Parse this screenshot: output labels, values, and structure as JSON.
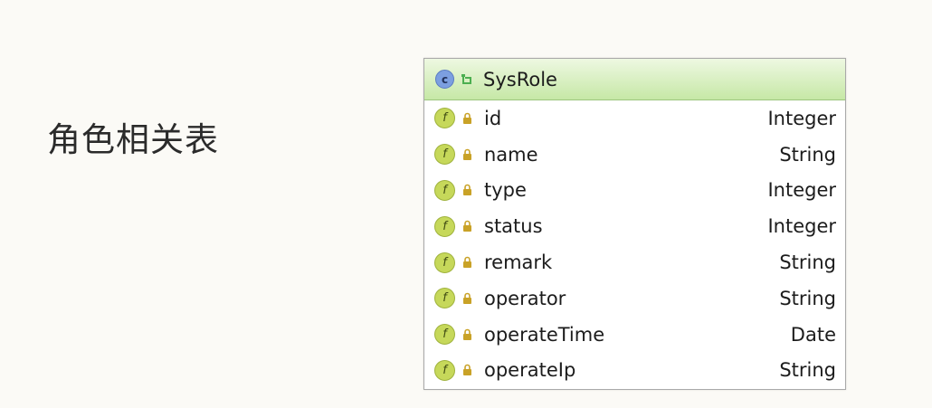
{
  "page_title": "角色相关表",
  "class_panel": {
    "class_icon_letter": "c",
    "class_name": "SysRole",
    "field_icon_letter": "f",
    "fields": [
      {
        "name": "id",
        "type": "Integer"
      },
      {
        "name": "name",
        "type": "String"
      },
      {
        "name": "type",
        "type": "Integer"
      },
      {
        "name": "status",
        "type": "Integer"
      },
      {
        "name": "remark",
        "type": "String"
      },
      {
        "name": "operator",
        "type": "String"
      },
      {
        "name": "operateTime",
        "type": "Date"
      },
      {
        "name": "operateIp",
        "type": "String"
      }
    ]
  },
  "icons": {
    "class": "class-icon",
    "visibility": "public-icon",
    "field": "field-icon",
    "lock": "lock-icon"
  },
  "colors": {
    "header_gradient_top": "#eef8e2",
    "header_gradient_bottom": "#c6e8a6",
    "class_icon": "#7c9fe0",
    "field_icon": "#c6d85a",
    "lock": "#c9a227",
    "public": "#4caf50"
  }
}
